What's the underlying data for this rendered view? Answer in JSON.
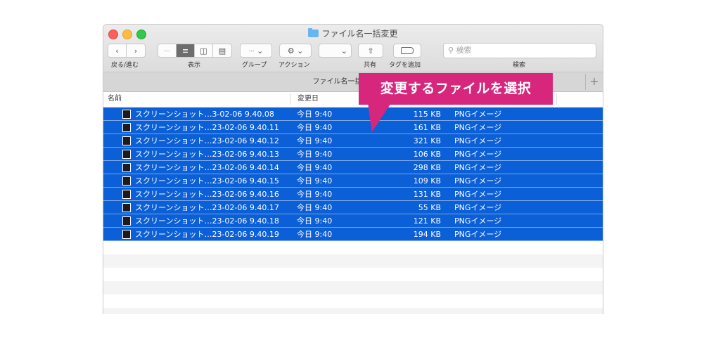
{
  "window": {
    "title": "ファイル名一括変更"
  },
  "toolbar": {
    "back_label": "戻る/進む",
    "view_label": "表示",
    "group_label": "グループ",
    "action_label": "アクション",
    "share_label": "共有",
    "tag_label": "タグを追加",
    "search_label": "検索",
    "search_placeholder": "検索",
    "view_active": "list"
  },
  "tabs": {
    "active": "ファイル名一括変更",
    "add": "+"
  },
  "columns": {
    "name": "名前",
    "date": "変更日"
  },
  "callout": {
    "text": "変更するファイルを選択",
    "color": "#d6277d"
  },
  "files": [
    {
      "name": "スクリーンショット…3-02-06 9.40.08",
      "date": "今日 9:40",
      "size": "115 KB",
      "kind": "PNGイメージ"
    },
    {
      "name": "スクリーンショット…23-02-06 9.40.11",
      "date": "今日 9:40",
      "size": "161 KB",
      "kind": "PNGイメージ"
    },
    {
      "name": "スクリーンショット…23-02-06 9.40.12",
      "date": "今日 9:40",
      "size": "321 KB",
      "kind": "PNGイメージ"
    },
    {
      "name": "スクリーンショット…23-02-06 9.40.13",
      "date": "今日 9:40",
      "size": "106 KB",
      "kind": "PNGイメージ"
    },
    {
      "name": "スクリーンショット…23-02-06 9.40.14",
      "date": "今日 9:40",
      "size": "298 KB",
      "kind": "PNGイメージ"
    },
    {
      "name": "スクリーンショット…23-02-06 9.40.15",
      "date": "今日 9:40",
      "size": "109 KB",
      "kind": "PNGイメージ"
    },
    {
      "name": "スクリーンショット…23-02-06 9.40.16",
      "date": "今日 9:40",
      "size": "131 KB",
      "kind": "PNGイメージ"
    },
    {
      "name": "スクリーンショット…23-02-06 9.40.17",
      "date": "今日 9:40",
      "size": "55 KB",
      "kind": "PNGイメージ"
    },
    {
      "name": "スクリーンショット…23-02-06 9.40.18",
      "date": "今日 9:40",
      "size": "121 KB",
      "kind": "PNGイメージ"
    },
    {
      "name": "スクリーンショット…23-02-06 9.40.19",
      "date": "今日 9:40",
      "size": "194 KB",
      "kind": "PNGイメージ"
    }
  ],
  "selection_color": "#0b5fd7"
}
